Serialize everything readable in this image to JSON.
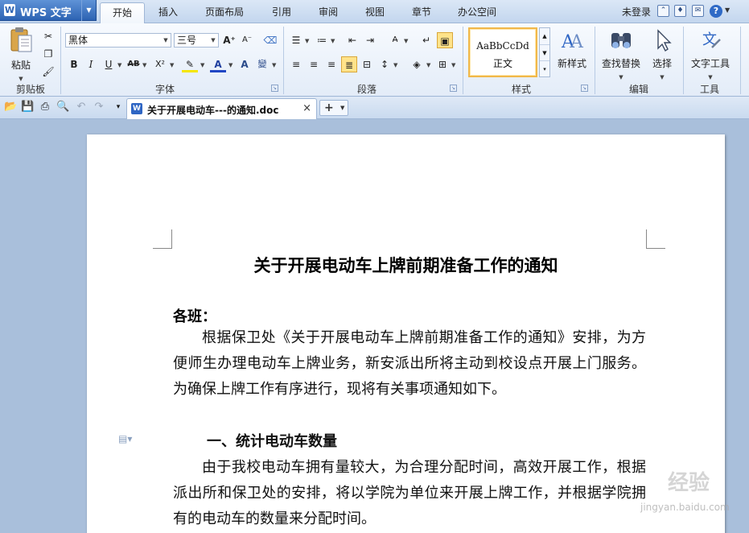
{
  "app": {
    "name": "WPS 文字",
    "logo_letter": "W"
  },
  "menu": {
    "tabs": [
      {
        "label": "开始",
        "active": true
      },
      {
        "label": "插入"
      },
      {
        "label": "页面布局"
      },
      {
        "label": "引用"
      },
      {
        "label": "审阅"
      },
      {
        "label": "视图"
      },
      {
        "label": "章节"
      },
      {
        "label": "办公空间"
      }
    ],
    "login": "未登录"
  },
  "ribbon": {
    "clipboard": {
      "paste_label": "粘贴",
      "group_label": "剪贴板"
    },
    "font": {
      "font_name": "黑体",
      "font_size": "三号",
      "group_label": "字体",
      "buttons": [
        "B",
        "I",
        "U",
        "AB",
        "X²",
        "A",
        "A"
      ]
    },
    "paragraph": {
      "group_label": "段落"
    },
    "styles": {
      "sample": "AaBbCcDd",
      "style_name": "正文",
      "new_style_label": "新样式",
      "group_label": "样式"
    },
    "editing": {
      "find_replace_label": "查找替换",
      "select_label": "选择",
      "group_label": "编辑"
    },
    "tools": {
      "text_tools_label": "文字工具",
      "group_label": "工具"
    }
  },
  "document_tab": {
    "title": "关于开展电动车---的通知.doc",
    "new_tab": "+"
  },
  "document": {
    "title": "关于开展电动车上牌前期准备工作的通知",
    "salutation": "各班：",
    "paragraph1": "根据保卫处《关于开展电动车上牌前期准备工作的通知》安排，为方便师生办理电动车上牌业务，新安派出所将主动到校设点开展上门服务。为确保上牌工作有序进行，现将有关事项通知如下。",
    "heading1": "一、统计电动车数量",
    "paragraph2": "由于我校电动车拥有量较大，为合理分配时间，高效开展工作，根据派出所和保卫处的安排，将以学院为单位来开展上牌工作，并根据学院拥有的电动车的数量来分配时间。"
  },
  "watermark": {
    "main": "经验",
    "sub": "jingyan.baidu.com"
  },
  "colors": {
    "accent": "#2d63b3",
    "ribbon_bg": "#e3ecf8",
    "workspace": "#a9bfdb",
    "highlight": "#ffe38a"
  }
}
